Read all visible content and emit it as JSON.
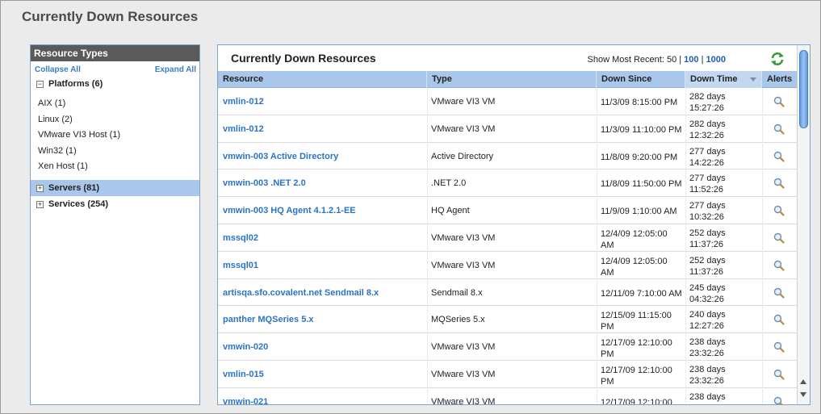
{
  "page": {
    "title": "Currently Down Resources"
  },
  "sidebar": {
    "header": "Resource Types",
    "collapse_all": "Collapse All",
    "expand_all": "Expand All",
    "platforms": {
      "label": "Platforms (6)",
      "toggle": "−",
      "children": [
        "AIX (1)",
        "Linux (2)",
        "VMware VI3 Host (1)",
        "Win32 (1)",
        "Xen Host (1)"
      ]
    },
    "servers": {
      "label": "Servers (81)",
      "toggle": "+"
    },
    "services": {
      "label": "Services (254)",
      "toggle": "+"
    }
  },
  "main": {
    "title": "Currently Down Resources",
    "show_recent_prefix": "Show Most Recent: 50 |",
    "show_100": "100",
    "sep": "|",
    "show_1000": "1000",
    "columns": {
      "resource": "Resource",
      "type": "Type",
      "down_since": "Down Since",
      "down_time": "Down Time",
      "alerts": "Alerts"
    },
    "rows": [
      {
        "resource": "vmlin-012",
        "type": "VMware VI3 VM",
        "since1": "11/3/09 8:15:00 PM",
        "since2": "",
        "down1": "282 days",
        "down2": "15:27:26"
      },
      {
        "resource": "vmlin-012",
        "type": "VMware VI3 VM",
        "since1": "11/3/09 11:10:00 PM",
        "since2": "",
        "down1": "282 days",
        "down2": "12:32:26"
      },
      {
        "resource": "vmwin-003 Active Directory",
        "type": "Active Directory",
        "since1": "11/8/09 9:20:00 PM",
        "since2": "",
        "down1": "277 days",
        "down2": "14:22:26"
      },
      {
        "resource": "vmwin-003 .NET 2.0",
        "type": ".NET 2.0",
        "since1": "11/8/09 11:50:00 PM",
        "since2": "",
        "down1": "277 days",
        "down2": "11:52:26"
      },
      {
        "resource": "vmwin-003 HQ Agent 4.1.2.1-EE",
        "type": "HQ Agent",
        "since1": "11/9/09 1:10:00 AM",
        "since2": "",
        "down1": "277 days",
        "down2": "10:32:26"
      },
      {
        "resource": "mssql02",
        "type": "VMware VI3 VM",
        "since1": "12/4/09 12:05:00",
        "since2": "AM",
        "down1": "252 days",
        "down2": "11:37:26"
      },
      {
        "resource": "mssql01",
        "type": "VMware VI3 VM",
        "since1": "12/4/09 12:05:00",
        "since2": "AM",
        "down1": "252 days",
        "down2": "11:37:26"
      },
      {
        "resource": "artisqa.sfo.covalent.net Sendmail 8.x",
        "type": "Sendmail 8.x",
        "since1": "12/11/09 7:10:00 AM",
        "since2": "",
        "down1": "245 days",
        "down2": "04:32:26"
      },
      {
        "resource": "panther MQSeries 5.x",
        "type": "MQSeries 5.x",
        "since1": "12/15/09 11:15:00",
        "since2": "PM",
        "down1": "240 days",
        "down2": "12:27:26"
      },
      {
        "resource": "vmwin-020",
        "type": "VMware VI3 VM",
        "since1": "12/17/09 12:10:00",
        "since2": "PM",
        "down1": "238 days",
        "down2": "23:32:26"
      },
      {
        "resource": "vmlin-015",
        "type": "VMware VI3 VM",
        "since1": "12/17/09 12:10:00",
        "since2": "PM",
        "down1": "238 days",
        "down2": "23:32:26"
      },
      {
        "resource": "vmwin-021",
        "type": "VMware VI3 VM",
        "since1": "12/17/09 12:10:00",
        "since2": "",
        "down1": "238 days",
        "down2": ""
      }
    ]
  },
  "colors": {
    "accent": "#2a74c4",
    "header_bg": "#a9c7ea",
    "panel_border": "#7fa3c9"
  },
  "icons": {
    "refresh": "refresh-icon",
    "alert": "magnifier-icon"
  }
}
